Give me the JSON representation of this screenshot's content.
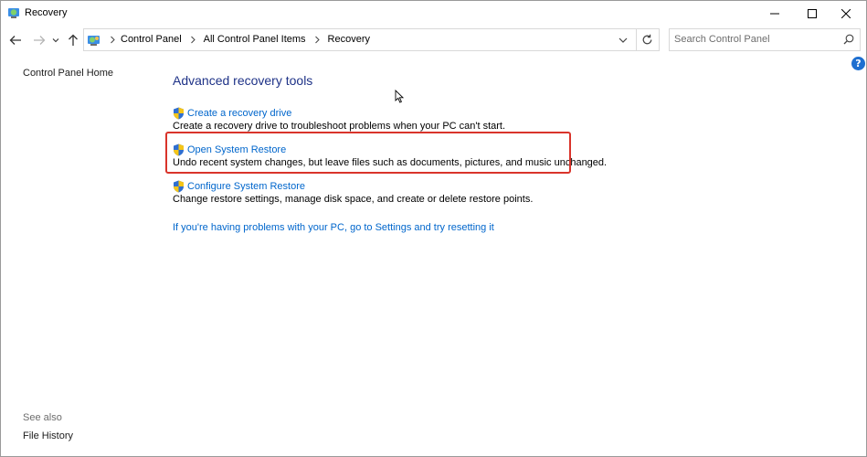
{
  "window": {
    "title": "Recovery"
  },
  "nav": {
    "breadcrumbs": [
      "Control Panel",
      "All Control Panel Items",
      "Recovery"
    ],
    "search_placeholder": "Search Control Panel"
  },
  "left_pane": {
    "home_link": "Control Panel Home",
    "see_also_label": "See also",
    "links": [
      "File History"
    ]
  },
  "main": {
    "heading": "Advanced recovery tools",
    "tasks": [
      {
        "label": "Create a recovery drive",
        "description": "Create a recovery drive to troubleshoot problems when your PC can't start."
      },
      {
        "label": "Open System Restore",
        "description": "Undo recent system changes, but leave files such as documents, pictures, and music unchanged."
      },
      {
        "label": "Configure System Restore",
        "description": "Change restore settings, manage disk space, and create or delete restore points."
      }
    ],
    "reset_link": "If you're having problems with your PC, go to Settings and try resetting it"
  },
  "colors": {
    "link": "#0066cc",
    "heading": "#1e3287",
    "highlight": "#d9342b",
    "help": "#1e6fd0"
  },
  "icons": [
    "recovery-app-icon",
    "back-arrow-icon",
    "forward-arrow-icon",
    "recent-dropdown-icon",
    "up-arrow-icon",
    "control-panel-icon",
    "chevron-right-icon",
    "chevron-down-icon",
    "refresh-icon",
    "search-icon",
    "help-icon",
    "uac-shield-icon",
    "minimize-icon",
    "maximize-icon",
    "close-icon"
  ]
}
